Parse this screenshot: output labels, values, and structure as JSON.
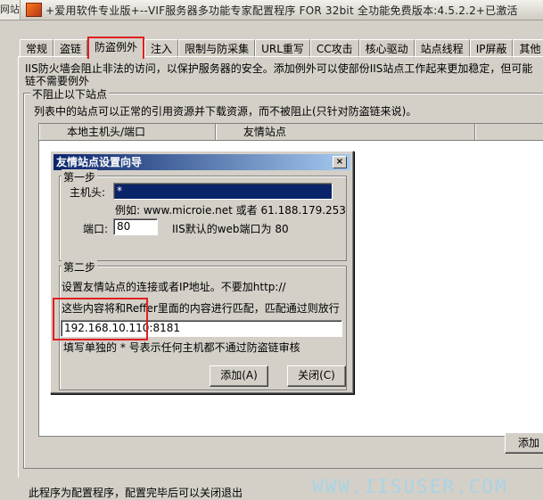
{
  "window": {
    "side_label": "网站",
    "title": "+爱用软件专业版+--VIF服务器多功能专家配置程序 FOR 32bit 全功能免费版本:4.5.2.2+已激活"
  },
  "tabs": [
    {
      "label": "常规"
    },
    {
      "label": "盗链"
    },
    {
      "label": "防盗例外"
    },
    {
      "label": "注入"
    },
    {
      "label": "限制与防采集"
    },
    {
      "label": "URL重写"
    },
    {
      "label": "CC攻击"
    },
    {
      "label": "核心驱动"
    },
    {
      "label": "站点线程"
    },
    {
      "label": "IP屏蔽"
    },
    {
      "label": "其他"
    }
  ],
  "info": {
    "line1": "IIS防火墙会阻止非法的访问，以保护服务器的安全。添加例外可以使部份IIS站点工作起来更加稳定，但可能",
    "line2": "链不需要例外"
  },
  "group": {
    "title": "不阻止以下站点",
    "desc": "列表中的站点可以正常的引用资源并下载资源，而不被阻止(只针对防盗链来说)。"
  },
  "list": {
    "columns": [
      "本地主机头/端口",
      "友情站点"
    ]
  },
  "buttons": {
    "add": "添加"
  },
  "status": "此程序为配置程序，配置完毕后可以关闭退出",
  "watermark": "WWW.IISUSER.COM",
  "dialog": {
    "title": "友情站点设置向导",
    "close": "×",
    "step1": {
      "legend": "第一步",
      "host_label": "主机头:",
      "host_value": "*",
      "example": "例如: www.microie.net 或者 61.188.179.253",
      "port_label": "端口:",
      "port_value": "80",
      "port_hint": "IIS默认的web端口为 80"
    },
    "step2": {
      "legend": "第二步",
      "instruction": "设置友情站点的连接或者IP地址。不要加http://",
      "match_note": "这些内容将和Reffer里面的内容进行匹配，匹配通过则放行",
      "address_value": "192.168.10.110:8181",
      "wildcard_note": "填写单独的 * 号表示任何主机都不通过防盗链审核"
    },
    "add": "添加(A)",
    "close_btn": "关闭(C)"
  },
  "colors": {
    "highlight_box": "#e01f1f",
    "dialog_title": "#0a246a",
    "watermark": "#a9d3e4"
  }
}
